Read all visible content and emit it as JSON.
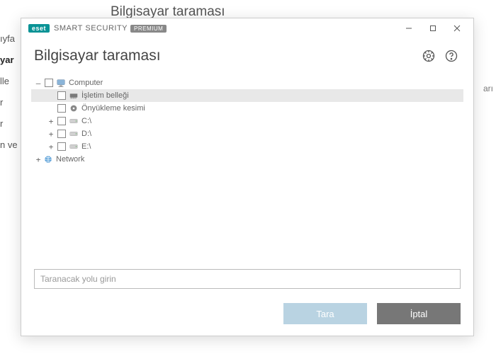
{
  "background": {
    "title": "Bilgisayar taraması",
    "left_items": [
      "ıyfa",
      "yar",
      "lle",
      "r",
      "r",
      "n ve"
    ],
    "right_text": "arı"
  },
  "titlebar": {
    "logo": "eset",
    "brand_light": "SMART",
    "brand_rest": " SECURITY",
    "premium": "PREMIUM"
  },
  "header": {
    "title": "Bilgisayar taraması"
  },
  "tree": [
    {
      "indent": 0,
      "exp": "—",
      "label": "Computer",
      "icon": "computer"
    },
    {
      "indent": 1,
      "exp": "",
      "label": "İşletim belleği",
      "icon": "memory",
      "sel": true
    },
    {
      "indent": 1,
      "exp": "",
      "label": "Önyükleme kesimi",
      "icon": "boot"
    },
    {
      "indent": 1,
      "exp": "+",
      "label": "C:\\",
      "icon": "drive"
    },
    {
      "indent": 1,
      "exp": "+",
      "label": "D:\\",
      "icon": "drive"
    },
    {
      "indent": 1,
      "exp": "+",
      "label": "E:\\",
      "icon": "drive"
    },
    {
      "indent": 0,
      "exp": "+",
      "label": "Network",
      "icon": "network",
      "nochk": true
    }
  ],
  "input": {
    "placeholder": "Taranacak yolu girin"
  },
  "buttons": {
    "scan": "Tara",
    "cancel": "İptal"
  }
}
